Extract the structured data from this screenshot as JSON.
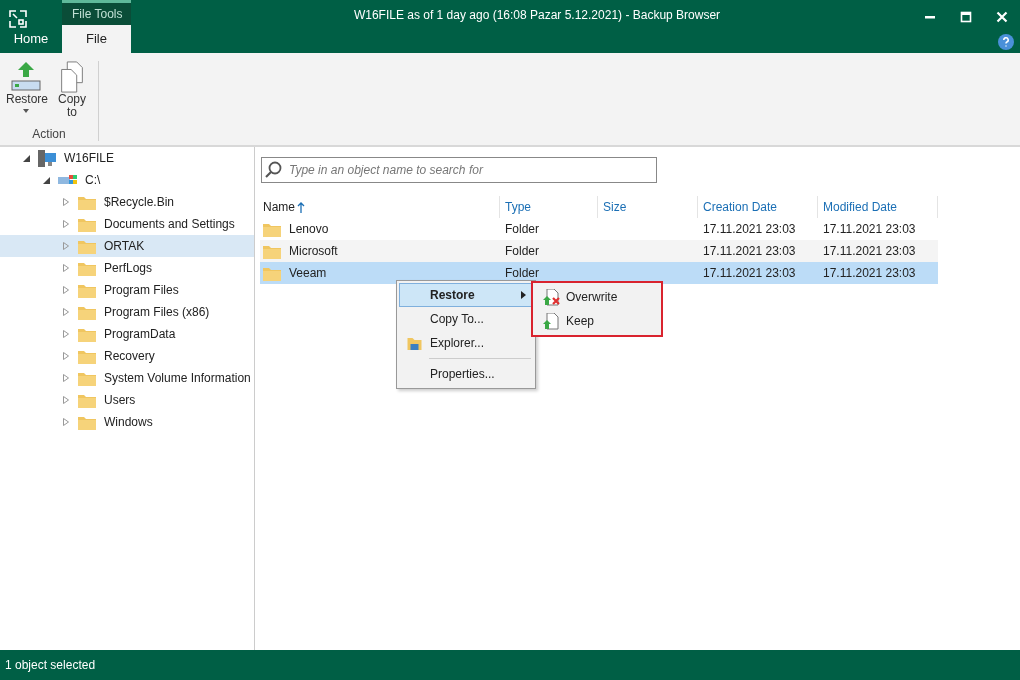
{
  "window": {
    "title": "W16FILE as of 1 day ago (16:08 Pazar 5.12.2021) - Backup Browser",
    "context_tab": "File Tools"
  },
  "tabs": [
    {
      "label": "Home",
      "selected": false
    },
    {
      "label": "File",
      "selected": true
    }
  ],
  "ribbon": {
    "buttons": [
      {
        "label": "Restore",
        "kind": "restore",
        "dropdown": true
      },
      {
        "label": "Copy to",
        "kind": "copy",
        "dropdown": false
      }
    ],
    "group": "Action"
  },
  "tree": [
    {
      "label": "W16FILE",
      "kind": "server",
      "expanded": true,
      "selected": false,
      "children": [
        {
          "label": "C:\\",
          "kind": "drive",
          "expanded": true,
          "selected": false,
          "children": [
            {
              "label": "$Recycle.Bin",
              "kind": "folder",
              "expanded": false,
              "selected": false
            },
            {
              "label": "Documents and Settings",
              "kind": "folder",
              "expanded": false,
              "selected": false
            },
            {
              "label": "ORTAK",
              "kind": "folder",
              "expanded": false,
              "selected": true
            },
            {
              "label": "PerfLogs",
              "kind": "folder",
              "expanded": false,
              "selected": false
            },
            {
              "label": "Program Files",
              "kind": "folder",
              "expanded": false,
              "selected": false
            },
            {
              "label": "Program Files (x86)",
              "kind": "folder",
              "expanded": false,
              "selected": false
            },
            {
              "label": "ProgramData",
              "kind": "folder",
              "expanded": false,
              "selected": false
            },
            {
              "label": "Recovery",
              "kind": "folder",
              "expanded": false,
              "selected": false
            },
            {
              "label": "System Volume Information",
              "kind": "folder",
              "expanded": false,
              "selected": false
            },
            {
              "label": "Users",
              "kind": "folder",
              "expanded": false,
              "selected": false
            },
            {
              "label": "Windows",
              "kind": "folder",
              "expanded": false,
              "selected": false
            }
          ]
        }
      ]
    }
  ],
  "search": {
    "placeholder": "Type in an object name to search for"
  },
  "table": {
    "columns": [
      "Name",
      "Type",
      "Size",
      "Creation Date",
      "Modified Date"
    ],
    "rows": [
      {
        "name": "Lenovo",
        "type": "Folder",
        "size": "",
        "created": "17.11.2021 23:03",
        "modified": "17.11.2021 23:03",
        "selected": false
      },
      {
        "name": "Microsoft",
        "type": "Folder",
        "size": "",
        "created": "17.11.2021 23:03",
        "modified": "17.11.2021 23:03",
        "selected": false
      },
      {
        "name": "Veeam",
        "type": "Folder",
        "size": "",
        "created": "17.11.2021 23:03",
        "modified": "17.11.2021 23:03",
        "selected": true
      }
    ]
  },
  "context_menu": {
    "items": [
      {
        "label": "Restore",
        "kind": "submenu",
        "selected": true
      },
      {
        "label": "Copy To...",
        "kind": "plain",
        "selected": false
      },
      {
        "label": "Explorer...",
        "kind": "explorer",
        "selected": false
      },
      {
        "label": "Properties...",
        "kind": "separated",
        "selected": false
      }
    ],
    "submenu": [
      {
        "label": "Overwrite",
        "kind": "overwrite"
      },
      {
        "label": "Keep",
        "kind": "keep"
      }
    ]
  },
  "status_bar": "1 object selected"
}
